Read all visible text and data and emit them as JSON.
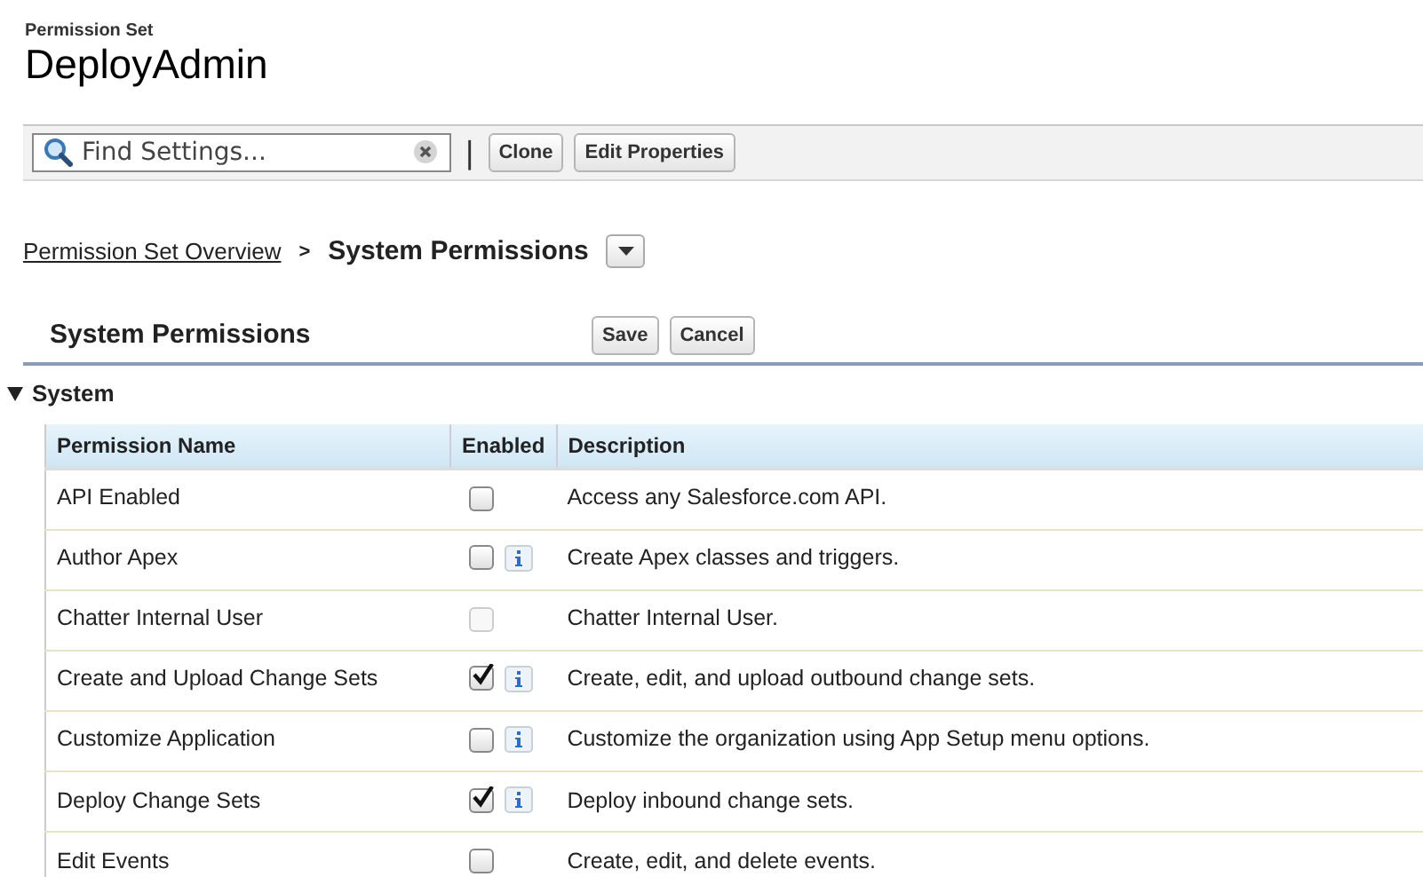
{
  "header": {
    "subtitle": "Permission Set",
    "title": "DeployAdmin"
  },
  "toolbar": {
    "search": {
      "placeholder": "Find Settings..."
    },
    "separator": "|",
    "buttons": [
      "Clone",
      "Edit Properties"
    ]
  },
  "breadcrumb": {
    "link": "Permission Set Overview",
    "separator": ">",
    "current": "System Permissions"
  },
  "section": {
    "title": "System Permissions",
    "buttons": [
      "Save",
      "Cancel"
    ]
  },
  "group": {
    "title": "System",
    "expanded": true,
    "columns": [
      "Permission Name",
      "Enabled",
      "Description"
    ],
    "rows": [
      {
        "name": "API Enabled",
        "checked": false,
        "disabled": false,
        "info": false,
        "description": "Access any Salesforce.com API."
      },
      {
        "name": "Author Apex",
        "checked": false,
        "disabled": false,
        "info": true,
        "description": "Create Apex classes and triggers."
      },
      {
        "name": "Chatter Internal User",
        "checked": false,
        "disabled": true,
        "info": false,
        "description": "Chatter Internal User."
      },
      {
        "name": "Create and Upload Change Sets",
        "checked": true,
        "disabled": false,
        "info": true,
        "description": "Create, edit, and upload outbound change sets."
      },
      {
        "name": "Customize Application",
        "checked": false,
        "disabled": false,
        "info": true,
        "description": "Customize the organization using App Setup menu options."
      },
      {
        "name": "Deploy Change Sets",
        "checked": true,
        "disabled": false,
        "info": true,
        "description": "Deploy inbound change sets."
      },
      {
        "name": "Edit Events",
        "checked": false,
        "disabled": false,
        "info": false,
        "description": "Create, edit, and delete events."
      }
    ]
  }
}
